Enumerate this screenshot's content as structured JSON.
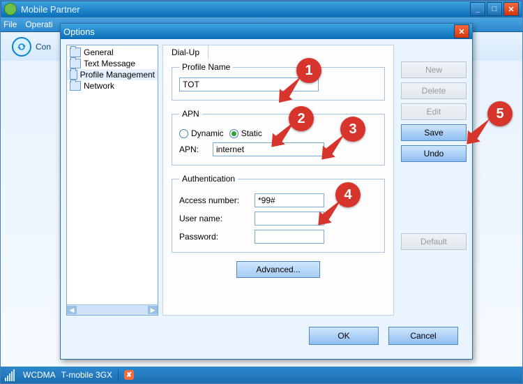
{
  "window": {
    "title": "Mobile Partner",
    "menu": {
      "file": "File",
      "operation": "Operati"
    },
    "connect_label": "Con"
  },
  "statusbar": {
    "tech": "WCDMA",
    "carrier": "T-mobile 3GX"
  },
  "dialog": {
    "title": "Options",
    "tree": {
      "general": "General",
      "text_message": "Text Message",
      "profile_management": "Profile Management",
      "network": "Network"
    },
    "tab_dialup": "Dial-Up",
    "profile": {
      "legend": "Profile Name",
      "value": "TOT"
    },
    "apn": {
      "legend": "APN",
      "dynamic": "Dynamic",
      "static": "Static",
      "label": "APN:",
      "value": "internet"
    },
    "auth": {
      "legend": "Authentication",
      "access_label": "Access number:",
      "access_value": "*99#",
      "user_label": "User name:",
      "user_value": "",
      "pass_label": "Password:",
      "pass_value": ""
    },
    "advanced": "Advanced...",
    "buttons": {
      "new": "New",
      "delete": "Delete",
      "edit": "Edit",
      "save": "Save",
      "undo": "Undo",
      "default": "Default"
    },
    "ok": "OK",
    "cancel": "Cancel"
  },
  "annotations": {
    "b1": "1",
    "b2": "2",
    "b3": "3",
    "b4": "4",
    "b5": "5"
  }
}
